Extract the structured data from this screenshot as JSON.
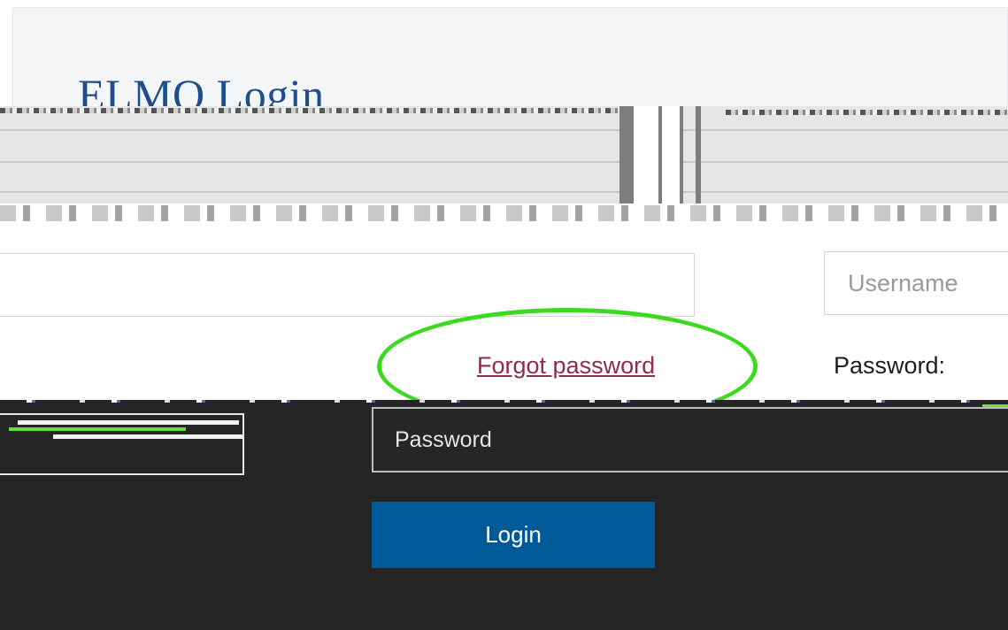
{
  "page": {
    "title": "ELMO Login"
  },
  "form": {
    "username_placeholder": "Username",
    "forgot_password_label": "Forgot password",
    "password_label": "Password:",
    "password_placeholder": "Password",
    "login_label": "Login"
  },
  "colors": {
    "title": "#1f4e8c",
    "link": "#8e2d4b",
    "highlight": "#3adb1e",
    "login_button": "#005a97",
    "dark_panel": "#252525"
  }
}
